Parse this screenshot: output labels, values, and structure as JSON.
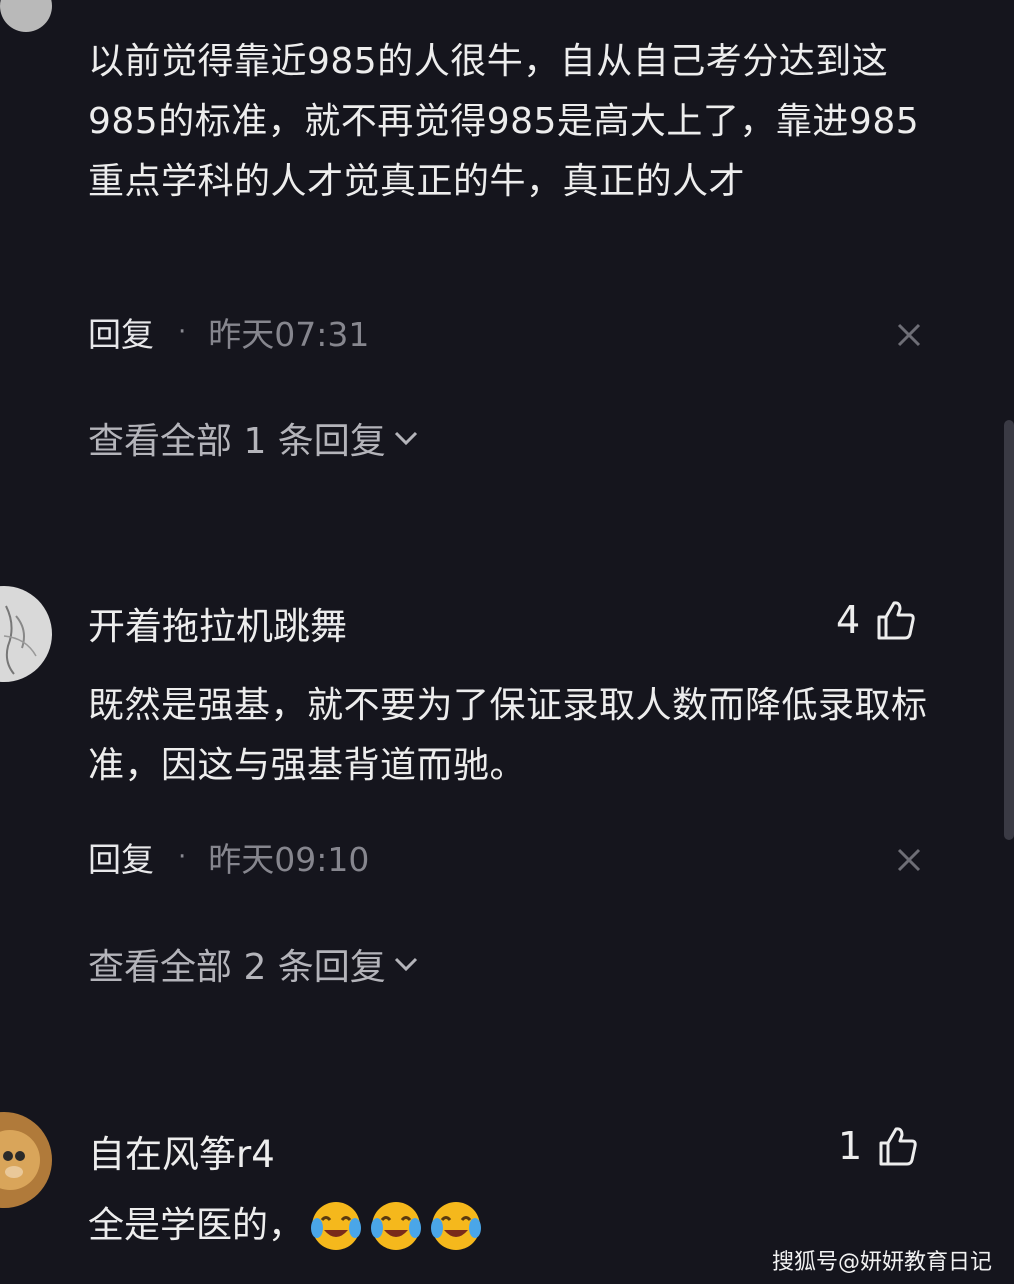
{
  "comments": [
    {
      "text": "以前觉得靠近985的人很牛，自从自己考分达到这985的标准，就不再觉得985是高大上了，靠进985重点学科的人才觉真正的牛，真正的人才",
      "reply_label": "回复",
      "separator": "·",
      "time": "昨天07:31",
      "view_replies": "查看全部 1 条回复"
    },
    {
      "username": "开着拖拉机跳舞",
      "likes": "4",
      "text": "既然是强基，就不要为了保证录取人数而降低录取标准，因这与强基背道而驰。",
      "reply_label": "回复",
      "separator": "·",
      "time": "昨天09:10",
      "view_replies": "查看全部 2 条回复"
    },
    {
      "username": "自在风筝r4",
      "likes": "1",
      "text": "全是学医的，"
    }
  ],
  "icons": {
    "like": "thumbs-up-icon",
    "close": "close-icon",
    "chevron": "chevron-down-icon",
    "emoji": "laughing-crying-emoji"
  },
  "watermark": "搜狐号@妍妍教育日记",
  "colors": {
    "background": "#15151d",
    "text": "#ededed",
    "muted": "#86868e"
  }
}
